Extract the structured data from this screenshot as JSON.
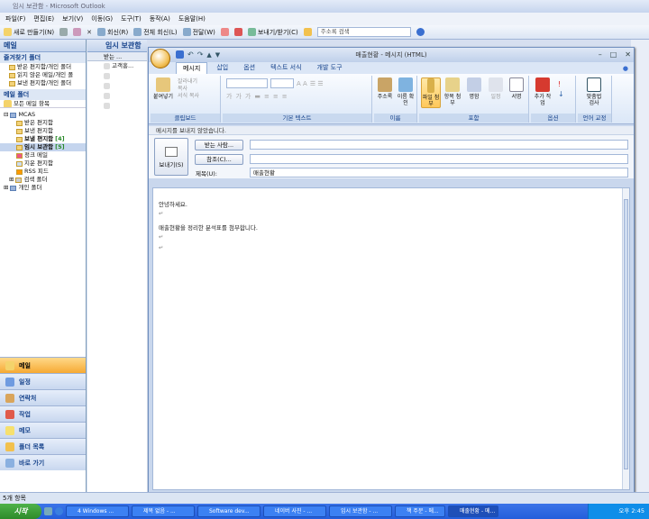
{
  "app": {
    "title": "임시 보관함 - Microsoft Outlook"
  },
  "menu": [
    "파일(F)",
    "편집(E)",
    "보기(V)",
    "이동(G)",
    "도구(T)",
    "동작(A)",
    "도움말(H)"
  ],
  "toolbar": {
    "new": "새로 만들기(N)",
    "reply": "회신(R)",
    "reply_all": "전체 회신(L)",
    "forward": "전달(W)",
    "send_receive": "보내기/받기(C)",
    "address_search_placeholder": "주소록 검색"
  },
  "nav": {
    "mail_title": "메일",
    "favorites_title": "즐겨찾기 폴더",
    "favorites": [
      "받은 편지함/개인 폴더",
      "읽지 않은 메일/개인 폴",
      "보낸 편지함/개인 폴더"
    ],
    "mail_folders_title": "메일 폴더",
    "all_items": "모든 메일 항목",
    "tree_root": "MCAS",
    "folders": [
      {
        "label": "받은 편지함",
        "count": ""
      },
      {
        "label": "보낸 편지함",
        "count": ""
      },
      {
        "label": "보낼 편지함",
        "count": "[4]"
      },
      {
        "label": "임시 보관함",
        "count": "[5]"
      },
      {
        "label": "정크 메일",
        "count": ""
      },
      {
        "label": "지운 편지함",
        "count": ""
      },
      {
        "label": "RSS 피드",
        "count": ""
      },
      {
        "label": "검색 폴더",
        "count": ""
      }
    ],
    "personal": "개인 폴더",
    "buttons": [
      "메일",
      "일정",
      "연락처",
      "작업",
      "메모",
      "폴더 목록",
      "바로 가기"
    ]
  },
  "list": {
    "title": "임시 보관함",
    "header": "받는 ...",
    "rows": [
      "고객홍..."
    ]
  },
  "message": {
    "window_title": "매출현황 - 메시지 (HTML)",
    "tabs": [
      "메시지",
      "삽입",
      "옵션",
      "텍스트 서식",
      "개발 도구"
    ],
    "ribbon_groups": [
      "클립보드",
      "기본 텍스트",
      "이름",
      "포함",
      "옵션",
      "언어 교정"
    ],
    "clipboard": {
      "paste": "붙여넣기",
      "cut": "잘라내기",
      "copy": "복사",
      "format_painter": "서식 복사"
    },
    "names": {
      "address_book": "주소록",
      "check_names": "이름 확인"
    },
    "include": {
      "attach_file": "파일 첨부",
      "attach_item": "항목 첨부",
      "signature": "서명",
      "business_card": "명함",
      "calendar": "일정"
    },
    "options": {
      "follow_up": "추가 작업"
    },
    "proofing": {
      "spelling": "맞춤법 검사"
    },
    "info_bar": "메시지를 보내지 않았습니다.",
    "send_label": "보내기(S)",
    "to_label": "받는 사람...",
    "cc_label": "참조(C)...",
    "subject_label": "제목(U):",
    "subject_value": "매출현황",
    "body_lines": [
      "안녕하세요.",
      "매출현황을 정리한 분석표를 첨부합니다."
    ]
  },
  "status": "5개 항목",
  "taskbar": {
    "start": "시작",
    "tasks": [
      "4 Windows ...",
      "제목 없음 - ...",
      "Software dev...",
      "네이버 사진 - ...",
      "임시 보관함 - ...",
      "책 주문 - 메...",
      "매출현황 - 메..."
    ],
    "clock": "오후 2:45"
  },
  "colors": {
    "accent": "#f6a933",
    "taskbar": "#245edb",
    "ribbon": "#dbe7f7"
  }
}
